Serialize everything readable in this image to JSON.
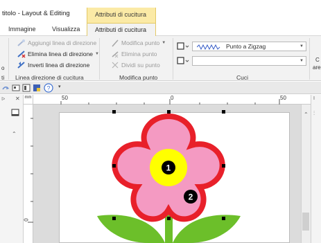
{
  "window": {
    "title": "titolo - Layout & Editing",
    "context_tab_header": "Attributi di cucitura"
  },
  "tabs": [
    {
      "label": "Immagine"
    },
    {
      "label": "Visualizza"
    },
    {
      "label": "Attributi di cucitura",
      "active": true
    }
  ],
  "ribbon": {
    "groups": {
      "direction": {
        "label": "Linea direzione di cucitura",
        "items": [
          {
            "label": "Aggiungi linea di direzione",
            "icon": "add-direction-line-icon",
            "disabled": true
          },
          {
            "label": "Elimina linea di direzione",
            "icon": "delete-direction-line-icon",
            "disabled": false
          },
          {
            "label": "Inverti linea di direzione",
            "icon": "invert-direction-line-icon",
            "disabled": false
          }
        ]
      },
      "point": {
        "label": "Modifica punto",
        "items": [
          {
            "label": "Modifica punto",
            "icon": "edit-point-icon",
            "disabled": true
          },
          {
            "label": "Elimina punto",
            "icon": "delete-point-icon",
            "disabled": true
          },
          {
            "label": "Dividi su punto",
            "icon": "split-point-icon",
            "disabled": true
          }
        ]
      },
      "stitch": {
        "label": "Cuci",
        "stitch_value": "Punto a Zigzag"
      }
    },
    "left_label_fragment_1": "o",
    "left_label_fragment_2": "ti",
    "right_label_fragment_1": "C",
    "right_label_fragment_2": "are"
  },
  "rulers": {
    "top_unit": "mm",
    "top_ticks": [
      "50",
      "0",
      "50"
    ],
    "left_ticks": [
      "0"
    ]
  },
  "design": {
    "markers": [
      "1",
      "2"
    ],
    "colors": {
      "petal_fill": "#f49ac2",
      "petal_stroke": "#e8202a",
      "center": "#ffff00",
      "leaf": "#6cbf2a",
      "marker": "#000000"
    }
  }
}
